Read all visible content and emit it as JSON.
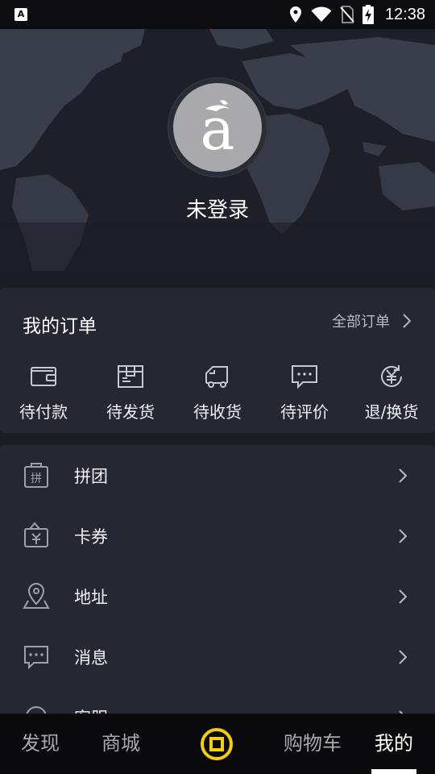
{
  "status_bar": {
    "app_badge": "A",
    "time": "12:38",
    "icons": [
      "location-icon",
      "wifi-icon",
      "no-sim-icon",
      "battery-charging-icon"
    ]
  },
  "profile": {
    "avatar_letter": "a",
    "username": "未登录"
  },
  "orders": {
    "title": "我的订单",
    "all_orders_label": "全部订单",
    "items": [
      {
        "label": "待付款",
        "icon": "wallet-icon"
      },
      {
        "label": "待发货",
        "icon": "package-icon"
      },
      {
        "label": "待收货",
        "icon": "truck-icon"
      },
      {
        "label": "待评价",
        "icon": "comment-icon"
      },
      {
        "label": "退/换货",
        "icon": "yuan-return-icon"
      }
    ]
  },
  "menu": {
    "items": [
      {
        "label": "拼团",
        "icon": "group-buy-icon"
      },
      {
        "label": "卡券",
        "icon": "coupon-icon"
      },
      {
        "label": "地址",
        "icon": "address-pin-icon"
      },
      {
        "label": "消息",
        "icon": "message-icon"
      },
      {
        "label": "客服",
        "icon": "customer-service-icon"
      }
    ]
  },
  "bottom_nav": {
    "items": [
      {
        "label": "发现",
        "active": false
      },
      {
        "label": "商城",
        "active": false
      },
      {
        "label": "购物车",
        "active": false
      },
      {
        "label": "我的",
        "active": true
      }
    ],
    "center_icon": "coin-icon",
    "accent_color": "#f4d000"
  }
}
